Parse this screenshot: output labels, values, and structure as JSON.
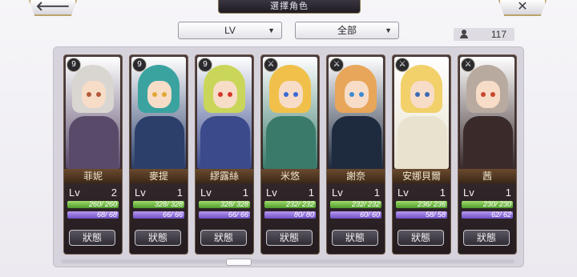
{
  "header": {
    "title": "選擇角色",
    "back_label": "🡐",
    "close_label": "✕"
  },
  "filters": {
    "sort_value": "LV",
    "type_value": "全部",
    "arrow": "▼"
  },
  "character_count": "117",
  "characters": [
    {
      "name": "菲妮",
      "lv_label": "Lv",
      "lv": "2",
      "hp": "260/ 260",
      "sp": "68/ 68",
      "status": "狀態",
      "badge": "9",
      "hair": "#d9d6d2",
      "body": "#5a4a6a",
      "eye": "#b35a3a"
    },
    {
      "name": "麥提",
      "lv_label": "Lv",
      "lv": "1",
      "hp": "328/ 328",
      "sp": "66/ 66",
      "status": "狀態",
      "badge": "9",
      "hair": "#3aa3a0",
      "body": "#2c3f6a",
      "eye": "#e0a832"
    },
    {
      "name": "繆露絲",
      "lv_label": "Lv",
      "lv": "1",
      "hp": "328/ 328",
      "sp": "66/ 66",
      "status": "狀態",
      "badge": "9",
      "hair": "#c9d65a",
      "body": "#3a4a8a",
      "eye": "#d6362a"
    },
    {
      "name": "米悠",
      "lv_label": "Lv",
      "lv": "1",
      "hp": "232/ 232",
      "sp": "80/ 80",
      "status": "狀態",
      "badge": "⚔",
      "hair": "#f0c04a",
      "body": "#3a7a6a",
      "eye": "#3a6ad6"
    },
    {
      "name": "謝奈",
      "lv_label": "Lv",
      "lv": "1",
      "hp": "232/ 232",
      "sp": "60/ 60",
      "status": "狀態",
      "badge": "⚔",
      "hair": "#e8a65a",
      "body": "#1e2a3e",
      "eye": "#3a8ad6"
    },
    {
      "name": "安娜貝爾",
      "lv_label": "Lv",
      "lv": "1",
      "hp": "236/ 236",
      "sp": "58/ 58",
      "status": "狀態",
      "badge": "⚔",
      "hair": "#f2d06a",
      "body": "#e8e2cf",
      "eye": "#3a6ab6"
    },
    {
      "name": "茜",
      "lv_label": "Lv",
      "lv": "1",
      "hp": "230/ 230",
      "sp": "62/ 62",
      "status": "狀態",
      "badge": "⚔",
      "hair": "#b9aaa0",
      "body": "#3a2a2a",
      "eye": "#c8462a"
    }
  ]
}
